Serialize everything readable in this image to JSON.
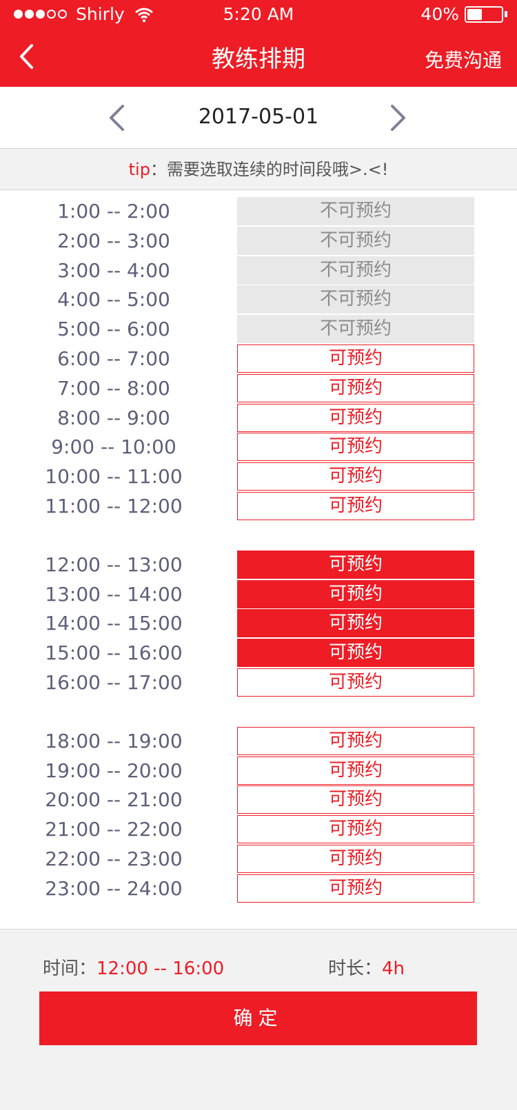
{
  "status_bar": {
    "carrier": "Shirly",
    "time": "5:20 AM",
    "battery": "40%"
  },
  "header": {
    "title": "教练排期",
    "right_action": "免费沟通"
  },
  "date_nav": {
    "date": "2017-05-01"
  },
  "tip": {
    "key": "tip",
    "text": "：需要选取连续的时间段哦>.<!"
  },
  "slots": [
    {
      "time": "1:00 -- 2:00",
      "label": "不可预约",
      "state": "unavailable"
    },
    {
      "time": "2:00 -- 3:00",
      "label": "不可预约",
      "state": "unavailable"
    },
    {
      "time": "3:00 -- 4:00",
      "label": "不可预约",
      "state": "unavailable"
    },
    {
      "time": "4:00 -- 5:00",
      "label": "不可预约",
      "state": "unavailable"
    },
    {
      "time": "5:00 -- 6:00",
      "label": "不可预约",
      "state": "unavailable"
    },
    {
      "time": "6:00 -- 7:00",
      "label": "可预约",
      "state": "available"
    },
    {
      "time": "7:00 -- 8:00",
      "label": "可预约",
      "state": "available"
    },
    {
      "time": "8:00 -- 9:00",
      "label": "可预约",
      "state": "available"
    },
    {
      "time": "9:00 -- 10:00",
      "label": "可预约",
      "state": "available"
    },
    {
      "time": "10:00 -- 11:00",
      "label": "可预约",
      "state": "available"
    },
    {
      "time": "11:00 -- 12:00",
      "label": "可预约",
      "state": "available"
    },
    {
      "time": "12:00 -- 13:00",
      "label": "可预约",
      "state": "selected"
    },
    {
      "time": "13:00 -- 14:00",
      "label": "可预约",
      "state": "selected"
    },
    {
      "time": "14:00 -- 15:00",
      "label": "可预约",
      "state": "selected"
    },
    {
      "time": "15:00 -- 16:00",
      "label": "可预约",
      "state": "selected"
    },
    {
      "time": "16:00 -- 17:00",
      "label": "可预约",
      "state": "available"
    },
    {
      "time": "18:00 -- 19:00",
      "label": "可预约",
      "state": "available"
    },
    {
      "time": "19:00 -- 20:00",
      "label": "可预约",
      "state": "available"
    },
    {
      "time": "20:00 -- 21:00",
      "label": "可预约",
      "state": "available"
    },
    {
      "time": "21:00 -- 22:00",
      "label": "可预约",
      "state": "available"
    },
    {
      "time": "22:00 -- 23:00",
      "label": "可预约",
      "state": "available"
    },
    {
      "time": "23:00 -- 24:00",
      "label": "可预约",
      "state": "available"
    }
  ],
  "summary": {
    "time_label": "时间：",
    "time_value": "12:00 -- 16:00",
    "duration_label": "时长：",
    "duration_value": "4h"
  },
  "confirm": {
    "label": "确定"
  },
  "colors": {
    "accent": "#ee1c25",
    "time_text": "#5c6079",
    "unavailable_bg": "#e8e8e8",
    "footer_bg": "#f2f2f2"
  },
  "icons": {
    "back": "chevron-left-icon",
    "prev_date": "chevron-left-icon",
    "next_date": "chevron-right-icon",
    "wifi": "wifi-icon",
    "battery": "battery-icon"
  }
}
